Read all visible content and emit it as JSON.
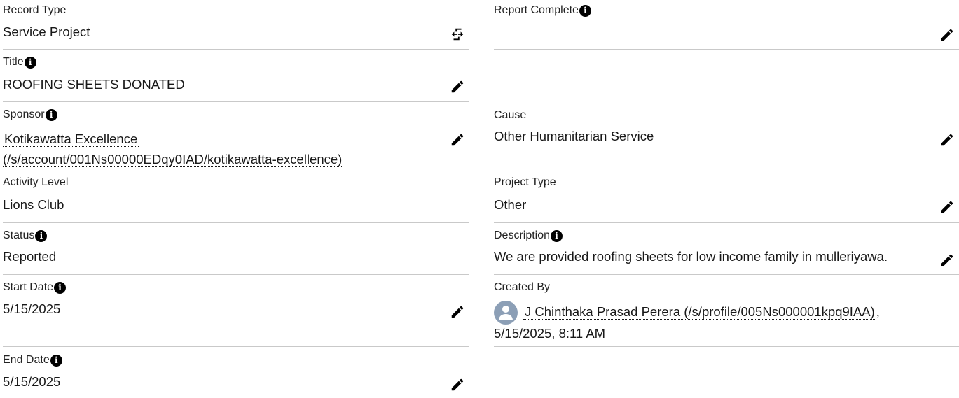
{
  "left_fields": {
    "record_type": {
      "label": "Record Type",
      "value": "Service Project"
    },
    "title": {
      "label": "Title",
      "value": "ROOFING SHEETS DONATED"
    },
    "sponsor": {
      "label": "Sponsor",
      "link_line1": "Kotikawatta Excellence",
      "link_line2": "(/s/account/001Ns00000EDqy0IAD/kotikawatta-excellence)"
    },
    "activity_level": {
      "label": "Activity Level",
      "value": "Lions Club"
    },
    "status": {
      "label": "Status",
      "value": "Reported"
    },
    "start_date": {
      "label": "Start Date",
      "value": "5/15/2025"
    },
    "end_date": {
      "label": "End Date",
      "value": "5/15/2025"
    }
  },
  "right_fields": {
    "report_complete": {
      "label": "Report Complete",
      "value": ""
    },
    "cause": {
      "label": "Cause",
      "value": "Other Humanitarian Service"
    },
    "project_type": {
      "label": "Project Type",
      "value": "Other"
    },
    "description": {
      "label": "Description",
      "value": "We are provided roofing sheets for low income family in mulleriyawa."
    },
    "created_by": {
      "label": "Created By",
      "user_link": "J Chinthaka Prasad Perera (/s/profile/005Ns000001kpq9IAA)",
      "separator": ",",
      "date": "5/15/2025, 8:11 AM"
    }
  },
  "icons": {
    "info": "info-circle-icon",
    "edit": "pencil-icon",
    "change_record_type": "change-record-type-icon",
    "avatar": "user-avatar-icon"
  },
  "colors": {
    "divider": "#c9c9c9",
    "avatar_bg": "#8c9fb6",
    "text": "#181818"
  }
}
